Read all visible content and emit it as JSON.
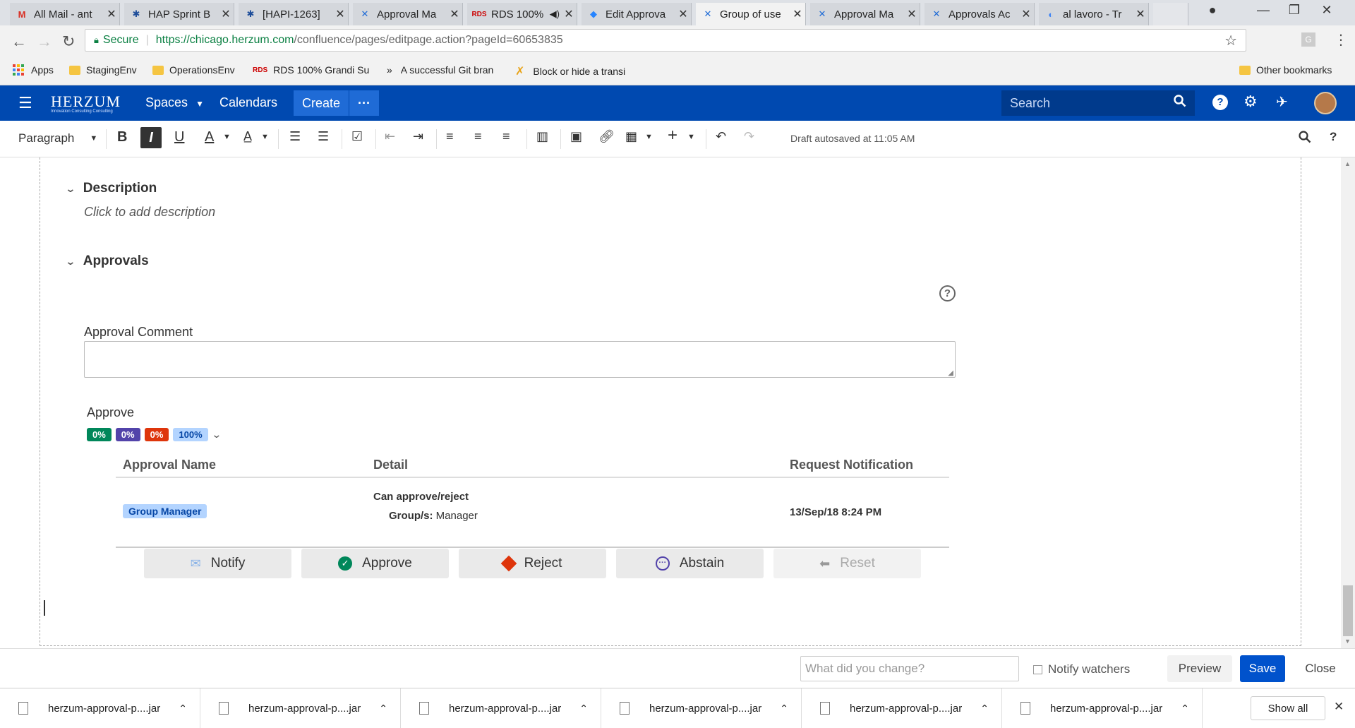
{
  "browser": {
    "tabs": [
      {
        "label": "All Mail - ant",
        "icon": "gmail-icon"
      },
      {
        "label": "HAP Sprint B",
        "icon": "jira-icon"
      },
      {
        "label": "[HAPI-1263]",
        "icon": "jira-icon"
      },
      {
        "label": "Approval Ma",
        "icon": "confluence-icon"
      },
      {
        "label": "RDS 100%",
        "icon": "rds-icon"
      },
      {
        "label": "Edit Approva",
        "icon": "diamond-icon"
      },
      {
        "label": "Group of use",
        "icon": "confluence-icon"
      },
      {
        "label": "Approval Ma",
        "icon": "confluence-icon"
      },
      {
        "label": "Approvals Ac",
        "icon": "confluence-icon"
      },
      {
        "label": "al lavoro - Tr",
        "icon": "translate-icon"
      }
    ],
    "secure_label": "Secure",
    "url_host": "https://chicago.herzum.com",
    "url_path": "/confluence/pages/editpage.action?pageId=60653835",
    "bookmarks": [
      "Apps",
      "StagingEnv",
      "OperationsEnv",
      "RDS 100% Grandi Su",
      "A successful Git bran",
      "Block or hide a transi"
    ],
    "other_bookmarks": "Other bookmarks"
  },
  "header": {
    "logo": "HERZUM",
    "logo_tagline": "Innovation Consulting Consulting",
    "spaces": "Spaces",
    "calendars": "Calendars",
    "create": "Create",
    "more": "···",
    "search_placeholder": "Search"
  },
  "toolbar": {
    "paragraph": "Paragraph",
    "autosave": "Draft autosaved at 11:05 AM"
  },
  "content": {
    "description_title": "Description",
    "description_placeholder": "Click to add description",
    "approvals_title": "Approvals",
    "approval_comment_label": "Approval Comment",
    "approve_label": "Approve",
    "pills": [
      "0%",
      "0%",
      "0%",
      "100%"
    ],
    "table": {
      "headers": [
        "Approval Name",
        "Detail",
        "Request Notification"
      ],
      "row": {
        "name": "Group Manager",
        "detail_title": "Can approve/reject",
        "detail_key": "Group/s:",
        "detail_value": "Manager",
        "notification": "13/Sep/18 8:24 PM"
      }
    },
    "actions": [
      "Notify",
      "Approve",
      "Reject",
      "Abstain",
      "Reset"
    ]
  },
  "savebar": {
    "change_placeholder": "What did you change?",
    "notify_watchers": "Notify watchers",
    "preview": "Preview",
    "save": "Save",
    "close": "Close"
  },
  "downloads": {
    "files": [
      "herzum-approval-p....jar",
      "herzum-approval-p....jar",
      "herzum-approval-p....jar",
      "herzum-approval-p....jar",
      "herzum-approval-p....jar",
      "herzum-approval-p....jar"
    ],
    "show_all": "Show all"
  },
  "colors": {
    "header_blue": "#0049b0",
    "create_blue": "#1f6bd6",
    "pill_green": "#00875a",
    "pill_purple": "#5243aa",
    "pill_red": "#de350b",
    "pill_light_blue": "#b3d4ff",
    "tag_bg": "#b3d4ff",
    "save_blue": "#0052cc"
  }
}
